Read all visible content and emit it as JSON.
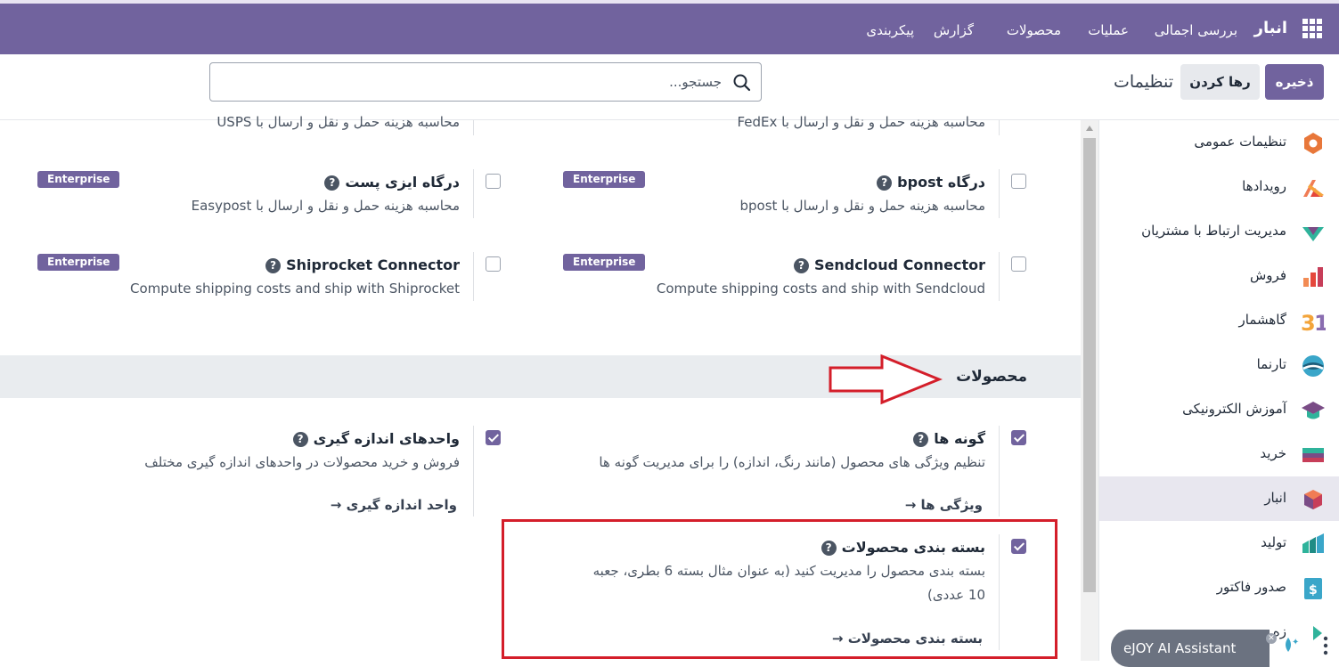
{
  "navbar": {
    "brand": "انبار",
    "menu": [
      "بررسی اجمالی",
      "عملیات",
      "محصولات",
      "گزارش",
      "پیکربندی"
    ]
  },
  "control": {
    "save_label": "ذخیره",
    "discard_label": "رها کردن",
    "title": "تنظیمات",
    "search_placeholder": "جستجو..."
  },
  "sidebar": {
    "items": [
      {
        "label": "تنظیمات عمومی",
        "icon": "general-settings-icon"
      },
      {
        "label": "رویدادها",
        "icon": "events-icon"
      },
      {
        "label": "مدیریت ارتباط با مشتریان",
        "icon": "crm-icon"
      },
      {
        "label": "فروش",
        "icon": "sales-icon"
      },
      {
        "label": "گاهشمار",
        "icon": "calendar-icon"
      },
      {
        "label": "تارنما",
        "icon": "website-icon"
      },
      {
        "label": "آموزش الکترونیکی",
        "icon": "elearning-icon"
      },
      {
        "label": "خرید",
        "icon": "purchase-icon"
      },
      {
        "label": "انبار",
        "icon": "inventory-icon",
        "active": true
      },
      {
        "label": "تولید",
        "icon": "manufacturing-icon"
      },
      {
        "label": "صدور فاکتور",
        "icon": "invoicing-icon"
      },
      {
        "label": "زه",
        "icon": "partial-app-icon"
      }
    ]
  },
  "shipping": {
    "fedex_desc": "محاسبه هزینه حمل و نقل و ارسال با FedEx",
    "usps_desc": "محاسبه هزینه حمل و نقل و ارسال با USPS",
    "bpost": {
      "title": "درگاه bpost",
      "desc": "محاسبه هزینه حمل و نقل و ارسال با bpost",
      "badge": "Enterprise"
    },
    "easypost": {
      "title": "درگاه ایزی پست",
      "desc": "محاسبه هزینه حمل و نقل و ارسال با Easypost",
      "badge": "Enterprise"
    },
    "sendcloud": {
      "title": "Sendcloud Connector",
      "desc": "Compute shipping costs and ship with Sendcloud",
      "badge": "Enterprise"
    },
    "shiprocket": {
      "title": "Shiprocket Connector",
      "desc": "Compute shipping costs and ship with Shiprocket",
      "badge": "Enterprise"
    }
  },
  "products_section": {
    "title": "محصولات",
    "variants": {
      "title": "گونه ها",
      "desc": "تنظیم ویژگی های محصول (مانند رنگ، اندازه) را برای مدیریت گونه ها",
      "link": "ویژگی ها",
      "checked": true
    },
    "uom": {
      "title": "واحدهای اندازه گیری",
      "desc": "فروش و خرید محصولات در واحدهای اندازه گیری مختلف",
      "link": "واحد اندازه گیری",
      "checked": true
    },
    "packaging": {
      "title": "بسته بندی محصولات",
      "desc_line1": "بسته بندی محصول را مدیریت کنید (به عنوان مثال بسته 6 بطری، جعبه",
      "desc_line2": "10 عددی)",
      "link": "بسته بندی محصولات",
      "checked": true
    }
  },
  "ejoy": {
    "label": "eJOY AI Assistant"
  },
  "colors": {
    "brand": "#71639e",
    "annotation_red": "#d41e2a"
  }
}
